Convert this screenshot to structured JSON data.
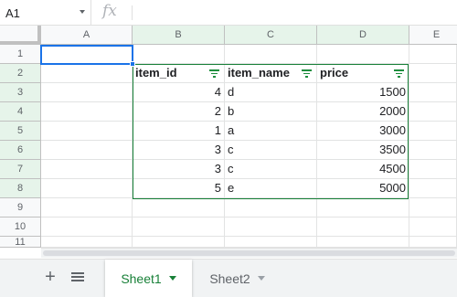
{
  "formula_bar": {
    "name_box": "A1",
    "fx_label": "fx",
    "formula_value": ""
  },
  "columns": [
    "A",
    "B",
    "C",
    "D",
    "E"
  ],
  "rows": [
    "1",
    "2",
    "3",
    "4",
    "5",
    "6",
    "7",
    "8",
    "9",
    "10",
    "11"
  ],
  "table": {
    "headers": [
      "item_id",
      "item_name",
      "price"
    ],
    "rows": [
      [
        "4",
        "d",
        "1500"
      ],
      [
        "2",
        "b",
        "2000"
      ],
      [
        "1",
        "a",
        "3000"
      ],
      [
        "3",
        "c",
        "3500"
      ],
      [
        "3",
        "c",
        "4500"
      ],
      [
        "5",
        "e",
        "5000"
      ]
    ]
  },
  "sheets": [
    {
      "label": "Sheet1",
      "active": true
    },
    {
      "label": "Sheet2",
      "active": false
    }
  ],
  "colors": {
    "table_border": "#188038",
    "active_cell": "#1a73e8",
    "selected_header": "#e6f4ea",
    "active_tab_text": "#188038"
  }
}
